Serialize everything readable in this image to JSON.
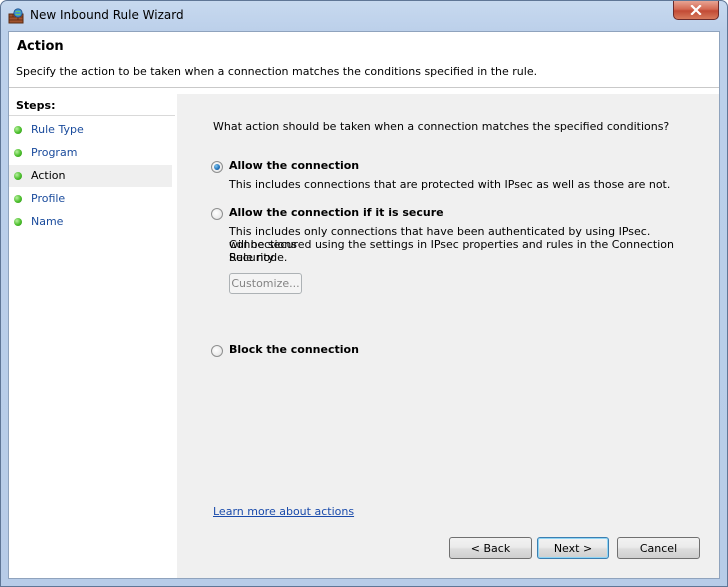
{
  "window": {
    "title": "New Inbound Rule Wizard"
  },
  "header": {
    "title": "Action",
    "description": "Specify the action to be taken when a connection matches the conditions specified in the rule."
  },
  "steps": {
    "title": "Steps:",
    "items": [
      {
        "label": "Rule Type"
      },
      {
        "label": "Program"
      },
      {
        "label": "Action",
        "active": true
      },
      {
        "label": "Profile"
      },
      {
        "label": "Name"
      }
    ]
  },
  "main": {
    "question": "What action should be taken when a connection matches the specified conditions?",
    "options": [
      {
        "label": "Allow the connection",
        "checked": true,
        "description": "This includes connections that are protected with IPsec as well as those are not."
      },
      {
        "label": "Allow the connection if it is secure",
        "checked": false,
        "description": [
          "This includes only connections that have been authenticated by using IPsec.  Connections",
          "will be secured using the settings in IPsec properties and rules in the Connection Security",
          "Rule node."
        ]
      },
      {
        "label": "Block the connection",
        "checked": false
      }
    ],
    "customize_label": "Customize...",
    "learn_more": "Learn more about actions"
  },
  "buttons": {
    "back": "< Back",
    "next": "Next >",
    "cancel": "Cancel"
  },
  "colors": {
    "link": "#1a4bab",
    "step_dot": "#4cbf2c",
    "close_button": "#c24a35"
  }
}
